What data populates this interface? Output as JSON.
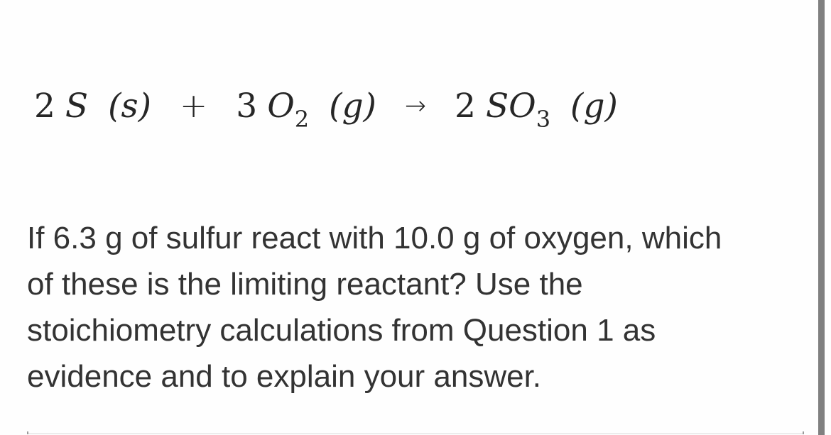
{
  "equation": {
    "reactant1": {
      "coefficient": "2",
      "species": "S",
      "subscript": "",
      "state": "(s)"
    },
    "plus": "+",
    "reactant2": {
      "coefficient": "3",
      "species": "O",
      "subscript": "2",
      "state": "(g)"
    },
    "arrow": "→",
    "product": {
      "coefficient": "2",
      "species": "SO",
      "subscript": "3",
      "state": "(g)"
    }
  },
  "question": {
    "lines": [
      "If 6.3 g of sulfur react with 10.0 g of oxygen, which",
      "of these is the limiting reactant? Use the",
      "stoichiometry calculations from Question 1 as",
      "evidence and to explain your answer."
    ]
  }
}
